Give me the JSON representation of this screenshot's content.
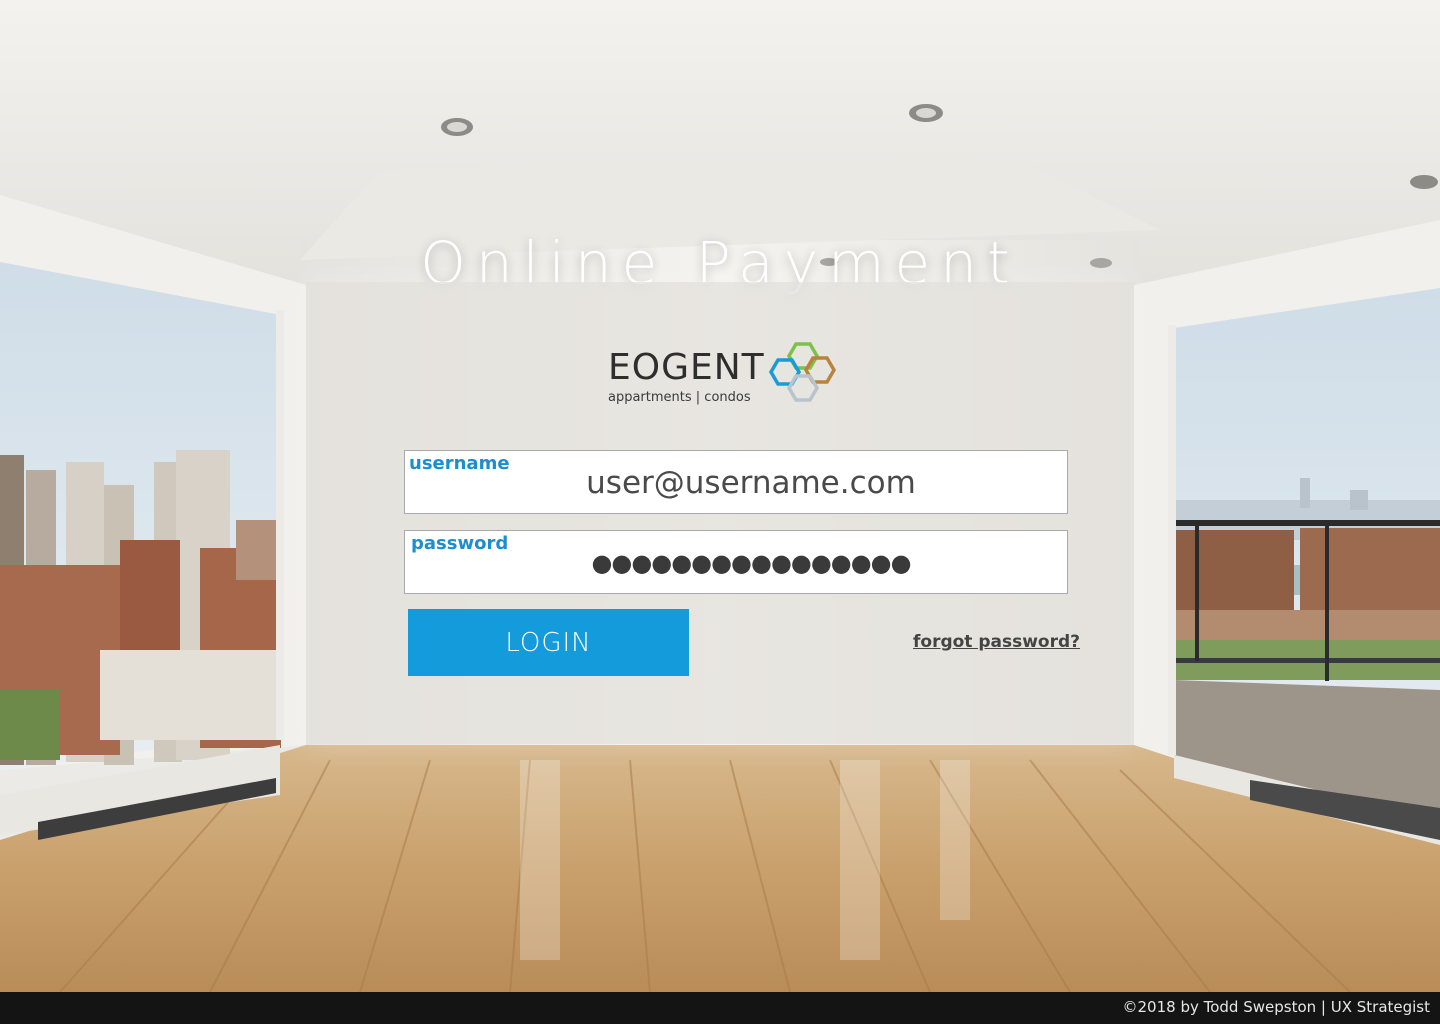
{
  "page": {
    "title": "Online Payment"
  },
  "brand": {
    "name": "EOGENT",
    "tagline": "appartments | condos",
    "colors": {
      "hex_green": "#7cc24a",
      "hex_bronze": "#b9833c",
      "hex_blue": "#1a9ad6",
      "hex_grey": "#b8c4cc"
    }
  },
  "login_form": {
    "username": {
      "label": "username",
      "value": "user@username.com"
    },
    "password": {
      "label": "password",
      "masked_value": "●●●●●●●●●●●●●●●●"
    },
    "login_button": "LOGIN",
    "forgot_link": "forgot password?"
  },
  "footer": {
    "credit": "©2018 by Todd Swepston | UX Strategist"
  },
  "theme": {
    "accent": "#139bdb",
    "label_color": "#1a8fcf",
    "footer_bg": "#141414"
  }
}
